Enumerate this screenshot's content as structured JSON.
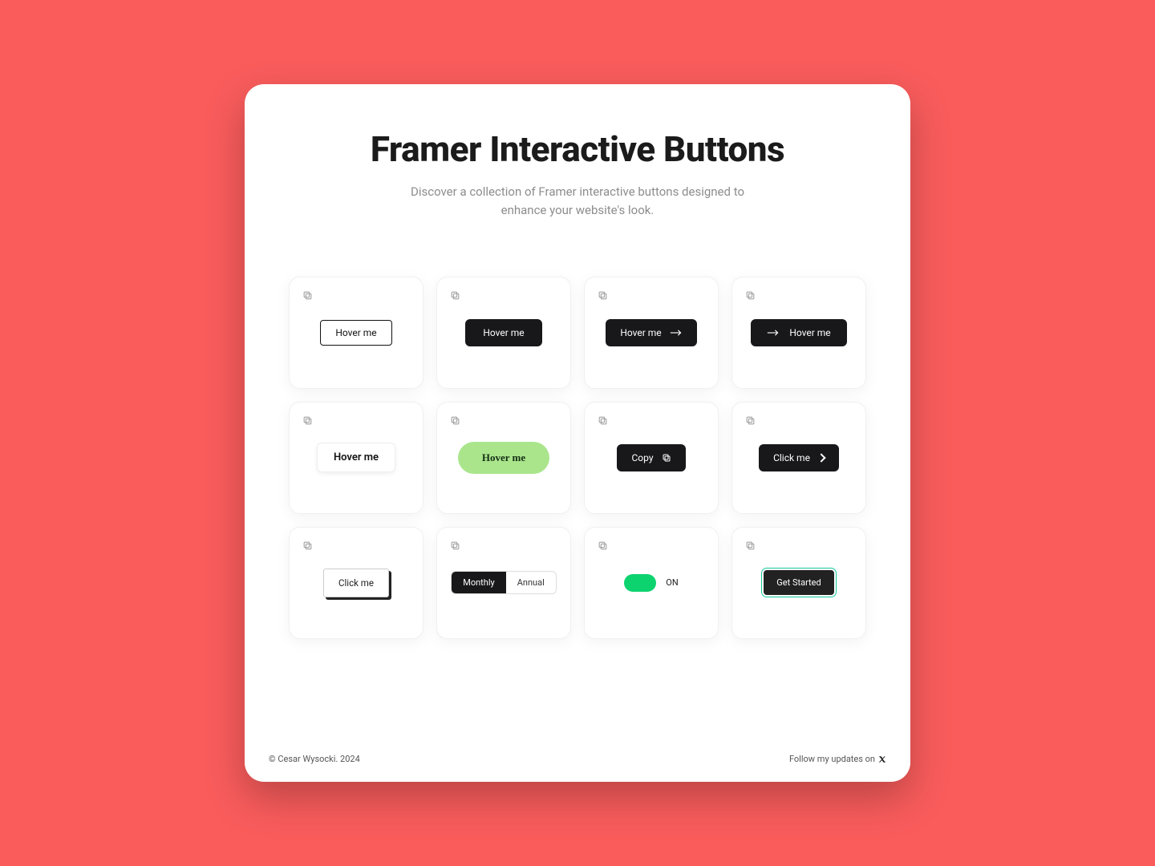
{
  "header": {
    "title": "Framer Interactive Buttons",
    "subtitle": "Discover a collection of Framer interactive buttons designed to enhance your website's look."
  },
  "cards": [
    {
      "label": "Hover me"
    },
    {
      "label": "Hover me"
    },
    {
      "label": "Hover me"
    },
    {
      "label": "Hover me"
    },
    {
      "label": "Hover me"
    },
    {
      "label": "Hover me"
    },
    {
      "label": "Copy"
    },
    {
      "label": "Click me"
    },
    {
      "label": "Click me"
    },
    {
      "seg_a": "Monthly",
      "seg_b": "Annual"
    },
    {
      "toggle_label": "ON"
    },
    {
      "label": "Get Started"
    }
  ],
  "footer": {
    "copyright": "© Cesar Wysocki. 2024",
    "follow": "Follow my updates on"
  }
}
